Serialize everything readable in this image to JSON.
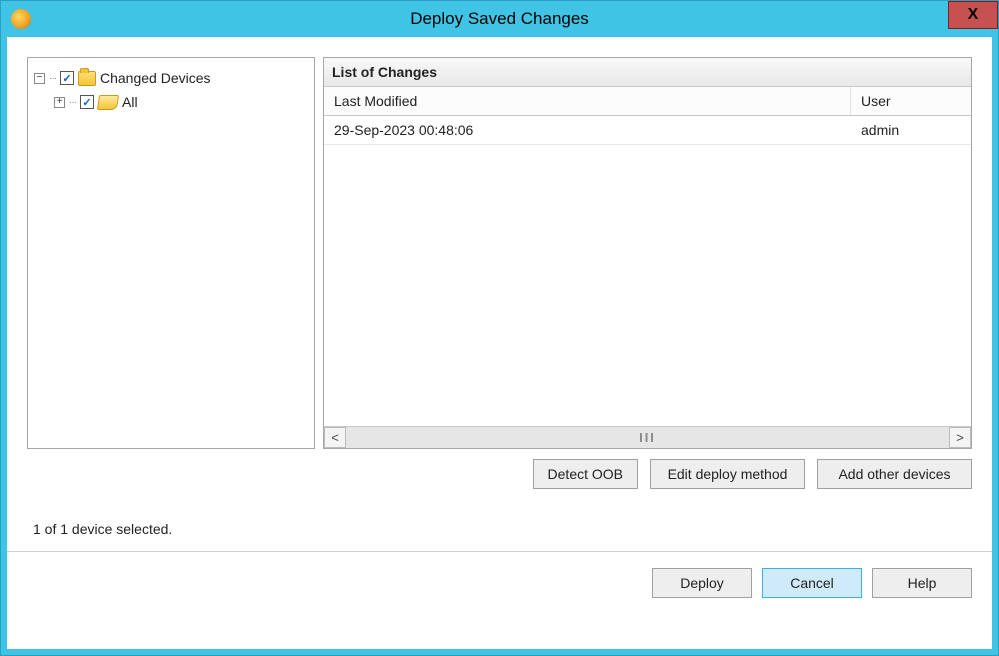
{
  "window": {
    "title": "Deploy Saved Changes"
  },
  "tree": {
    "root": {
      "label": "Changed Devices",
      "checked": true
    },
    "child": {
      "label": "All",
      "checked": true
    }
  },
  "changes": {
    "title": "List of Changes",
    "columns": {
      "modified": "Last Modified",
      "user": "User"
    },
    "rows": [
      {
        "modified": "29-Sep-2023 00:48:06",
        "user": "admin"
      }
    ]
  },
  "actions": {
    "detect_oob": "Detect OOB",
    "edit_deploy": "Edit deploy method",
    "add_devices": "Add other devices"
  },
  "status": "1 of 1 device selected.",
  "footer": {
    "deploy": "Deploy",
    "cancel": "Cancel",
    "help": "Help"
  }
}
